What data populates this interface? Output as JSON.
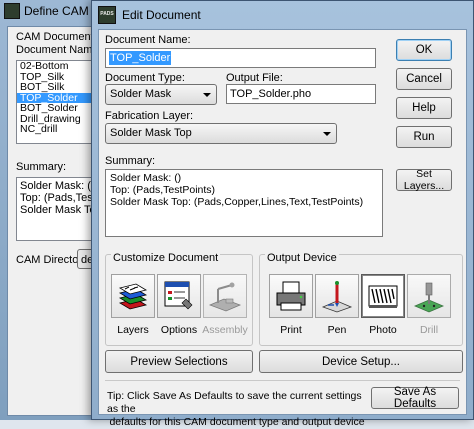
{
  "background_dialog": {
    "title": "Define CAM D",
    "documents_label": "CAM Documents",
    "document_name_label": "Document Name:",
    "documents": [
      "02-Bottom",
      "TOP_Silk",
      "BOT_Silk",
      "TOP_Solder",
      "BOT_Solder",
      "Drill_drawing",
      "NC_drill"
    ],
    "selected_document": "TOP_Solder",
    "summary_label": "Summary:",
    "summary_lines": [
      "Solder Mask: ()",
      "Top: (Pads,TestPoi",
      "Solder Mask Top"
    ],
    "directory_label": "CAM Directory:",
    "directory_value": "de"
  },
  "dialog": {
    "title": "Edit Document",
    "app_icon_text": "PADS",
    "document_name": {
      "label": "Document Name:",
      "value": "TOP_Solder"
    },
    "document_type": {
      "label": "Document Type:",
      "value": "Solder Mask"
    },
    "output_file": {
      "label": "Output File:",
      "value": "TOP_Solder.pho"
    },
    "fabrication_layer": {
      "label": "Fabrication Layer:",
      "value": "Solder Mask Top"
    },
    "summary": {
      "label": "Summary:",
      "lines": [
        "Solder Mask: ()",
        "Top: (Pads,TestPoints)",
        "Solder Mask Top: (Pads,Copper,Lines,Text,TestPoints)"
      ]
    },
    "buttons": {
      "ok": "OK",
      "cancel": "Cancel",
      "help": "Help",
      "run": "Run",
      "set_layers": "Set Layers...",
      "preview_selections": "Preview Selections",
      "device_setup": "Device Setup...",
      "save_as_defaults": "Save As Defaults"
    },
    "customize": {
      "label": "Customize Document",
      "items": [
        {
          "label": "Layers",
          "icon": "layers-icon",
          "enabled": true
        },
        {
          "label": "Options",
          "icon": "options-icon",
          "enabled": true
        },
        {
          "label": "Assembly",
          "icon": "assembly-icon",
          "enabled": false
        }
      ]
    },
    "output_device": {
      "label": "Output Device",
      "items": [
        {
          "label": "Print",
          "icon": "printer-icon",
          "enabled": true,
          "selected": false
        },
        {
          "label": "Pen",
          "icon": "pen-plotter-icon",
          "enabled": true,
          "selected": false
        },
        {
          "label": "Photo",
          "icon": "photo-plotter-icon",
          "enabled": true,
          "selected": true
        },
        {
          "label": "Drill",
          "icon": "drill-icon",
          "enabled": false,
          "selected": false
        }
      ]
    },
    "tip_lines": [
      "Tip: Click Save As Defaults to save the current settings as the",
      "defaults for this CAM document type and output device"
    ]
  }
}
